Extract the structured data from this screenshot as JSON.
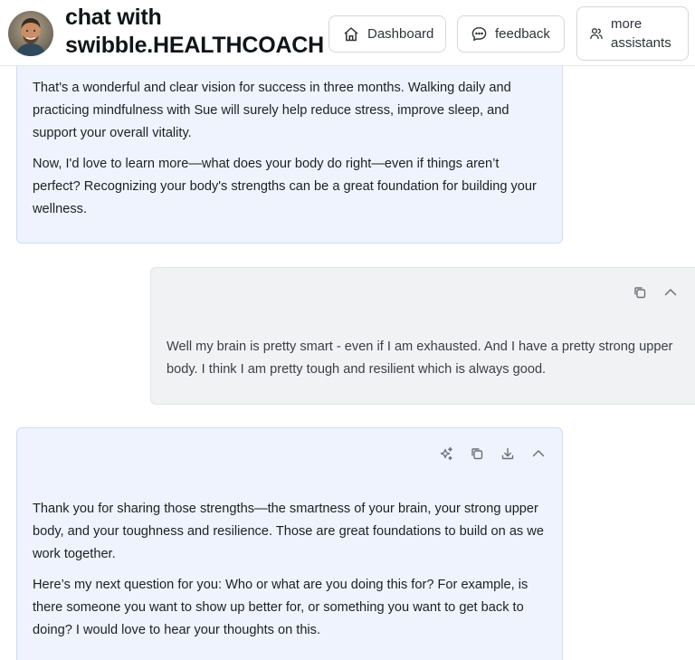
{
  "header": {
    "title_line1": "chat with",
    "title_line2": "swibble.HEALTHCOACH",
    "buttons": {
      "dashboard": "Dashboard",
      "feedback": "feedback",
      "more_line1": "more",
      "more_line2": "assistants"
    },
    "icons": {
      "dashboard": "home-icon",
      "feedback": "chat-bubble-icon",
      "more": "users-icon"
    }
  },
  "messages": [
    {
      "role": "assistant",
      "paragraphs": [
        "That's a wonderful and clear vision for success in three months. Walking daily and practicing mindfulness with Sue will surely help reduce stress, improve sleep, and support your overall vitality.",
        "Now, I'd love to learn more—what does your body do right—even if things aren’t perfect? Recognizing your body's strengths can be a great foundation for building your wellness."
      ]
    },
    {
      "role": "user",
      "actions": [
        "copy-icon",
        "chevron-up-icon"
      ],
      "paragraphs": [
        "Well my brain is pretty smart - even if I am exhausted. And I have a pretty strong upper body. I think I am pretty tough and resilient which is always good."
      ]
    },
    {
      "role": "assistant",
      "actions": [
        "sparkles-icon",
        "copy-icon",
        "download-icon",
        "chevron-up-icon"
      ],
      "paragraphs": [
        "Thank you for sharing those strengths—the smartness of your brain, your strong upper body, and your toughness and resilience. Those are great foundations to build on as we work together.",
        "Here’s my next question for you: Who or what are you doing this for? For example, is there someone you want to show up better for, or something you want to get back to doing? I would love to hear your thoughts on this."
      ]
    }
  ],
  "colors": {
    "assistant_bubble": "#eef3fe",
    "assistant_border": "#cfdcf7",
    "user_bubble": "#f1f2f4",
    "user_border": "#e2e4e8"
  }
}
